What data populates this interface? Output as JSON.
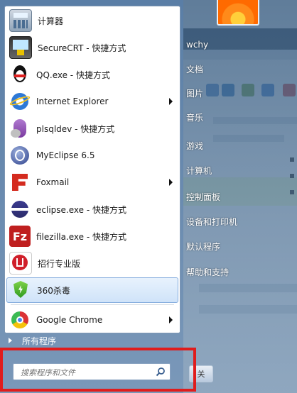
{
  "programs": [
    {
      "label": "计算器",
      "icon": "calculator-icon"
    },
    {
      "label": "SecureCRT - 快捷方式",
      "icon": "securecrt-icon"
    },
    {
      "label": "QQ.exe - 快捷方式",
      "icon": "qq-penguin-icon"
    },
    {
      "label": "Internet Explorer",
      "icon": "internet-explorer-icon"
    },
    {
      "label": "plsqldev - 快捷方式",
      "icon": "plsql-developer-icon"
    },
    {
      "label": "MyEclipse 6.5",
      "icon": "myeclipse-icon"
    },
    {
      "label": "Foxmail",
      "icon": "foxmail-icon"
    },
    {
      "label": "eclipse.exe - 快捷方式",
      "icon": "eclipse-icon"
    },
    {
      "label": "filezilla.exe - 快捷方式",
      "icon": "filezilla-icon"
    },
    {
      "label": "招行专业版",
      "icon": "cmb-bank-icon"
    },
    {
      "label": "360杀毒",
      "icon": "360-antivirus-icon"
    },
    {
      "label": "Google Chrome",
      "icon": "chrome-icon"
    }
  ],
  "all_programs": "所有程序",
  "search": {
    "placeholder": "搜索程序和文件"
  },
  "right": {
    "user": "wchy",
    "documents": "文档",
    "pictures": "图片",
    "music": "音乐",
    "games": "游戏",
    "computer": "计算机",
    "control_panel": "控制面板",
    "devices": "设备和打印机",
    "default_programs": "默认程序",
    "help": "帮助和支持"
  },
  "shutdown_label": "关"
}
